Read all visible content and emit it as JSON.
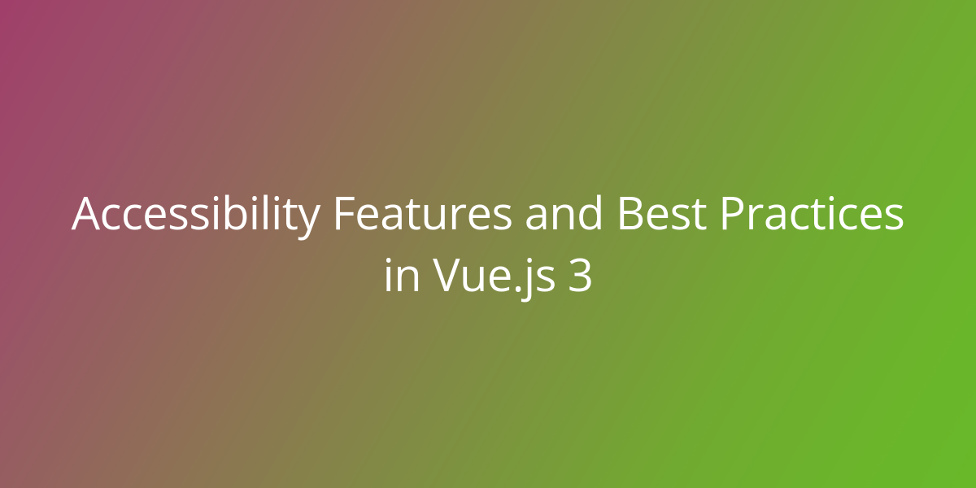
{
  "banner": {
    "title": "Accessibility Features and Best Practices in Vue.js 3",
    "gradient_start": "#a03f6a",
    "gradient_end": "#68b829",
    "text_color": "#ffffff"
  }
}
